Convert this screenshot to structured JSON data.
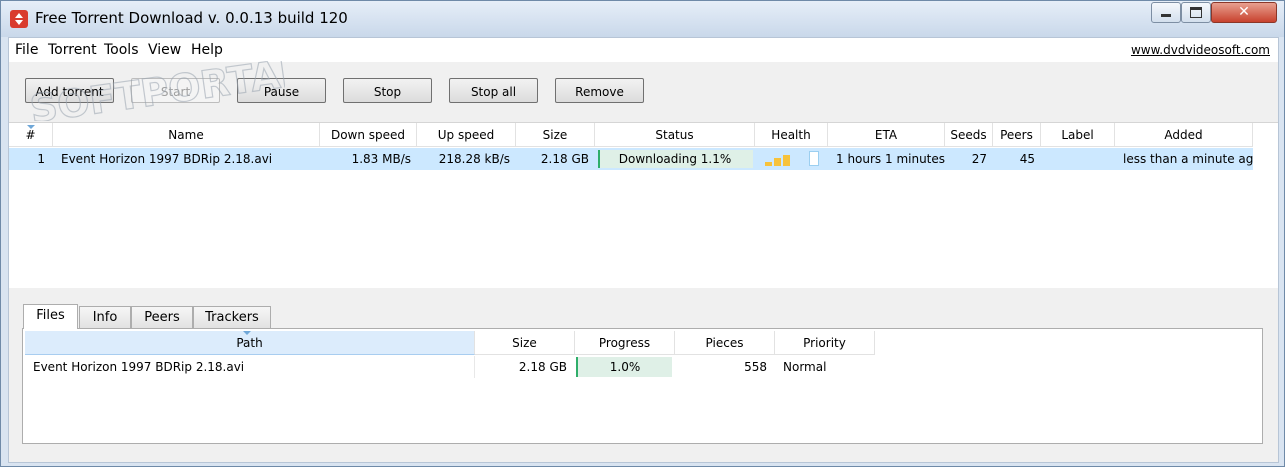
{
  "window": {
    "title": "Free Torrent Download v. 0.0.13 build 120",
    "close_glyph": "✕"
  },
  "menu": {
    "items": [
      "File",
      "Torrent",
      "Tools",
      "View",
      "Help"
    ],
    "site_link": "www.dvdvideosoft.com"
  },
  "toolbar": {
    "add_torrent": "Add torrent",
    "start": "Start",
    "pause": "Pause",
    "stop": "Stop",
    "stop_all": "Stop all",
    "remove": "Remove"
  },
  "torrents": {
    "columns": [
      "#",
      "Name",
      "Down speed",
      "Up speed",
      "Size",
      "Status",
      "Health",
      "ETA",
      "Seeds",
      "Peers",
      "Label",
      "Added"
    ],
    "rows": [
      {
        "num": "1",
        "name": "Event Horizon 1997 BDRip 2.18.avi",
        "down_speed": "1.83 MB/s",
        "up_speed": "218.28 kB/s",
        "size": "2.18 GB",
        "status": "Downloading 1.1%",
        "progress": 0.011,
        "health_bars": 4,
        "health_filled": 3,
        "eta": "1 hours 1 minutes",
        "seeds": "27",
        "peers": "45",
        "label": "",
        "added": "less than a minute ag"
      }
    ]
  },
  "details": {
    "tabs": [
      "Files",
      "Info",
      "Peers",
      "Trackers"
    ],
    "active_tab": "Files",
    "file_columns": [
      "Path",
      "Size",
      "Progress",
      "Pieces",
      "Priority"
    ],
    "files": [
      {
        "path": "Event Horizon 1997 BDRip 2.18.avi",
        "size": "2.18 GB",
        "progress": "1.0%",
        "pieces": "558",
        "priority": "Normal"
      }
    ]
  },
  "watermark": "SOFTPORTAL",
  "colors": {
    "selected_row": "#cce8ff",
    "progress_fill": "#2fae6a",
    "health": "#f7c23b"
  }
}
